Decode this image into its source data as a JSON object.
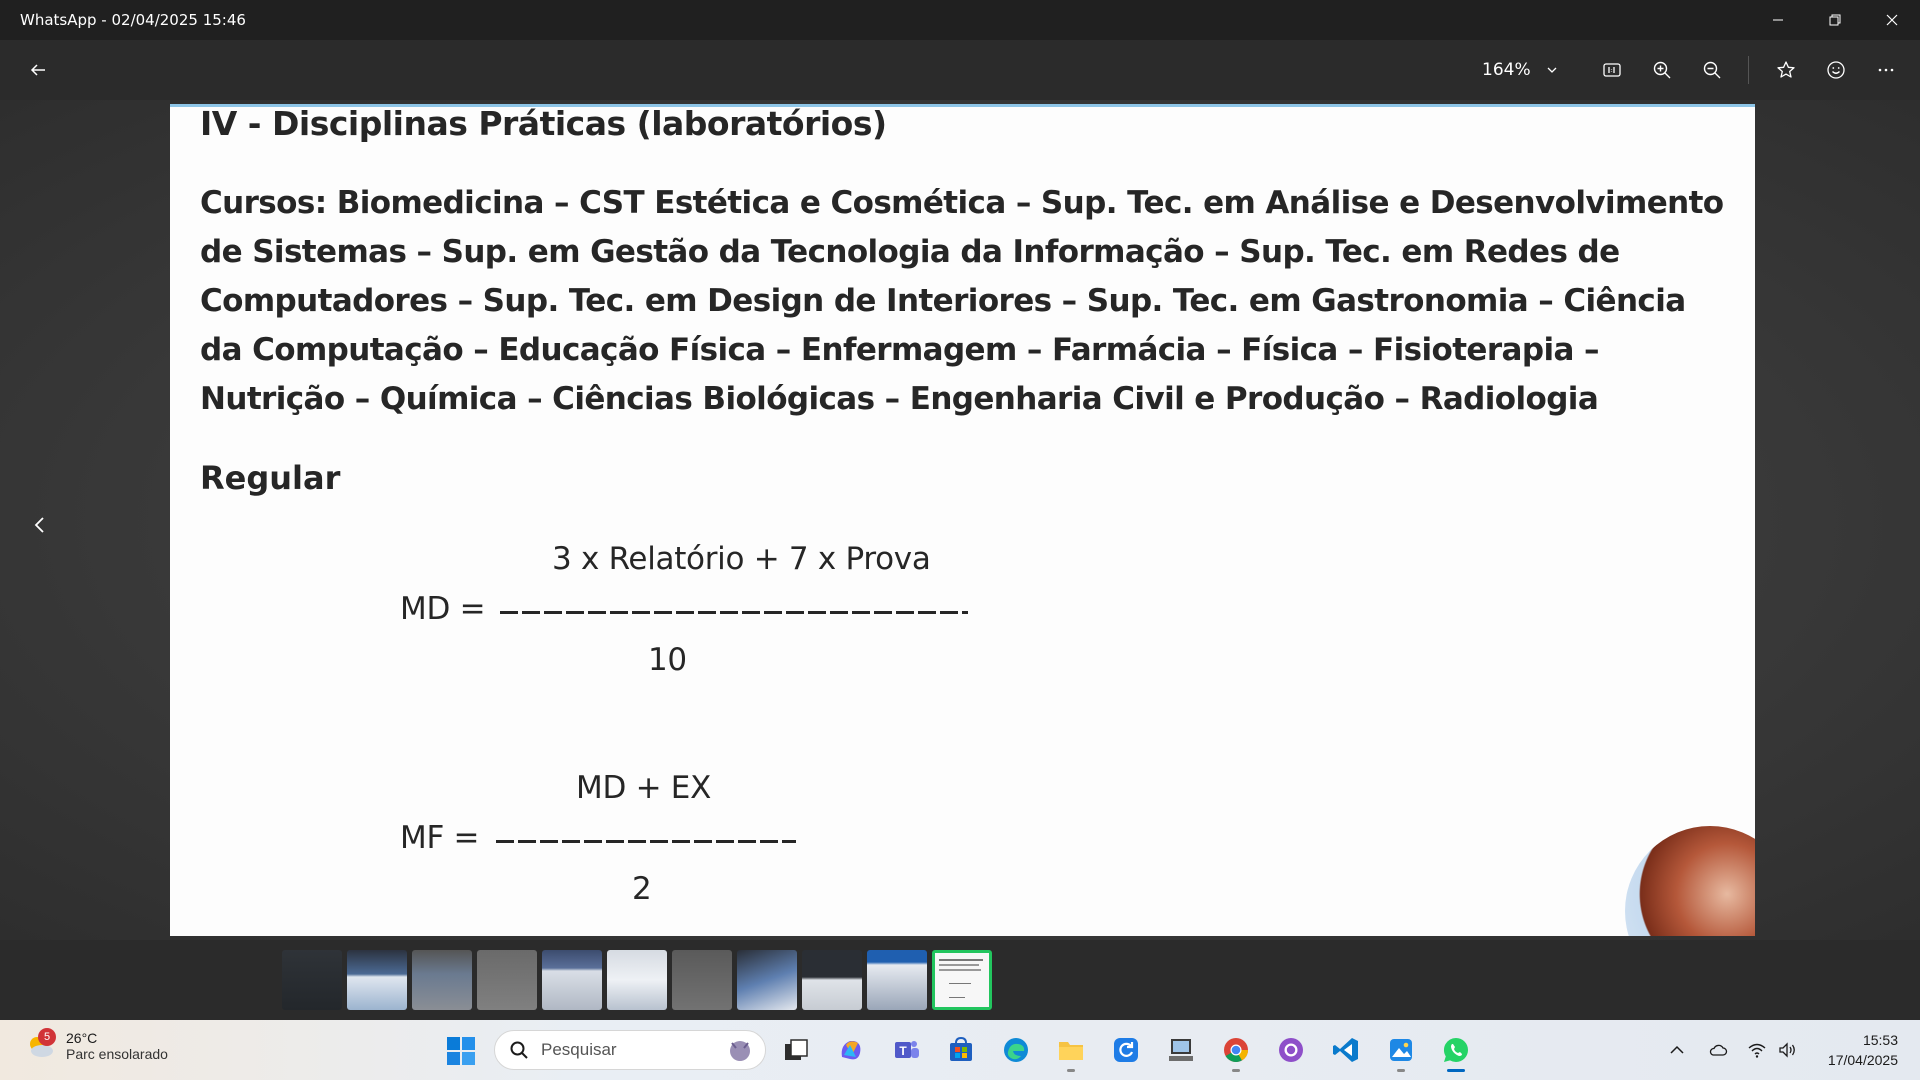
{
  "window": {
    "title": "WhatsApp - 02/04/2025 15:46"
  },
  "toolbar": {
    "zoom": "164%"
  },
  "document": {
    "heading": "IV - Disciplinas Práticas (laboratórios)",
    "courses": "Cursos: Biomedicina – CST Estética e Cosmética – Sup. Tec. em Análise e Desenvolvimento de Sistemas – Sup. em Gestão da Tecnologia da Informação – Sup. Tec. em Redes de Computadores – Sup. Tec. em Design de Interiores – Sup. Tec. em Gastronomia – Ciência da Computação – Educação Física – Enfermagem – Farmácia – Física – Fisioterapia – Nutrição – Química – Ciências Biológicas – Engenharia Civil e Produção – Radiologia",
    "section": "Regular",
    "formula_md": {
      "numerator": "3 x Relatório + 7 x Prova",
      "label": "MD =",
      "denominator": "10"
    },
    "formula_mf": {
      "numerator": "MD + EX",
      "label": "MF =",
      "denominator": "2"
    }
  },
  "filmstrip": {
    "count": 11,
    "active_index": 10
  },
  "taskbar": {
    "weather_badge": "5",
    "temperature": "26°C",
    "condition": "Parc ensolarado",
    "search_placeholder": "Pesquisar",
    "time": "15:53",
    "date": "17/04/2025"
  },
  "colors": {
    "accent_active": "#22c55e",
    "taskbar_active": "#0067c0"
  }
}
